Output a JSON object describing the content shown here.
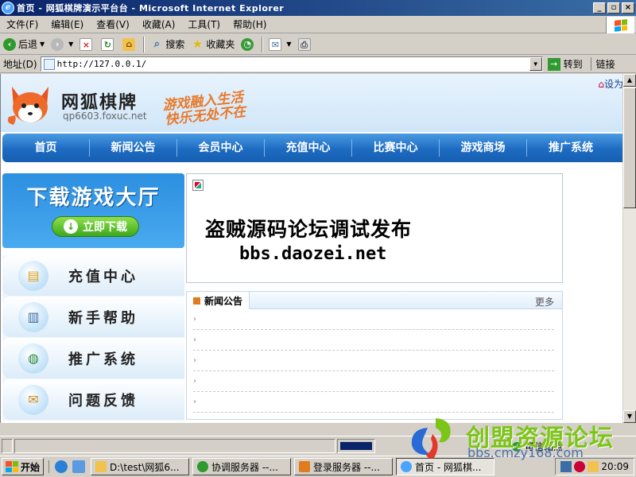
{
  "window": {
    "title": "首页 - 网狐棋牌演示平台台 - Microsoft Internet Explorer"
  },
  "menubar": {
    "items": [
      "文件(F)",
      "编辑(E)",
      "查看(V)",
      "收藏(A)",
      "工具(T)",
      "帮助(H)"
    ]
  },
  "toolbar": {
    "back": "后退",
    "search": "搜索",
    "favorites": "收藏夹"
  },
  "addressbar": {
    "label": "地址(D)",
    "url": "http://127.0.0.1/",
    "go": "转到",
    "links": "链接"
  },
  "site": {
    "name": "网狐棋牌",
    "domain": "qp6603.foxuc.net",
    "slogan_line1": "游戏融入生活",
    "slogan_line2": "快乐无处不在",
    "set_home": "设为"
  },
  "nav": {
    "items": [
      "首页",
      "新闻公告",
      "会员中心",
      "充值中心",
      "比赛中心",
      "游戏商场",
      "推广系统"
    ]
  },
  "download": {
    "title": "下载游戏大厅",
    "button": "立即下载"
  },
  "side_menu": {
    "items": [
      "充值中心",
      "新手帮助",
      "推广系统",
      "问题反馈"
    ]
  },
  "banner": {
    "line1": "盗贼源码论坛调试发布",
    "line2": "bbs.daozei.net"
  },
  "news": {
    "tab": "新闻公告",
    "more": "更多",
    "rows": [
      "",
      "",
      "",
      "",
      ""
    ]
  },
  "statusbar": {
    "zone": "可信站点"
  },
  "taskbar": {
    "start": "开始",
    "tasks": [
      "D:\\test\\网狐6...",
      "协调服务器 --...",
      "登录服务器 --...",
      "首页 - 网狐棋..."
    ],
    "clock": "20:09"
  },
  "watermark": {
    "title": "创盟资源论坛",
    "url": "bbs.cmzy168.com"
  },
  "colors": {
    "nav_blue": "#1d6bc2",
    "slogan_orange": "#e8792a",
    "download_green": "#3da81c",
    "titlebar_navy": "#0a246a"
  }
}
